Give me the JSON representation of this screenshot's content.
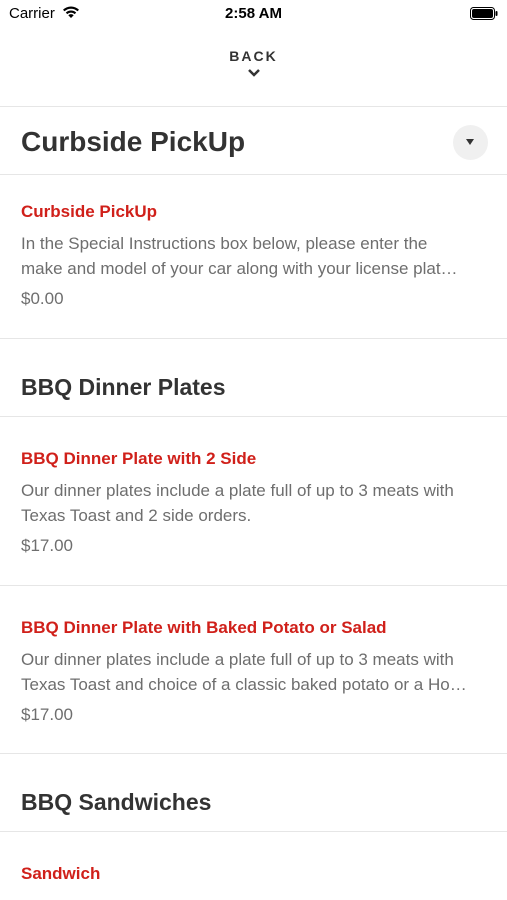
{
  "status_bar": {
    "carrier": "Carrier",
    "time": "2:58 AM"
  },
  "nav": {
    "back_label": "BACK"
  },
  "categories": [
    {
      "title": "Curbside PickUp",
      "items": [
        {
          "name": "Curbside PickUp",
          "desc_line1": "In the Special Instructions box below, please enter the",
          "desc_line2": "make and model of your car along with your license plat…",
          "price": "$0.00"
        }
      ]
    },
    {
      "title": "BBQ Dinner Plates",
      "items": [
        {
          "name": "BBQ Dinner Plate with 2 Side",
          "desc_line1": "Our dinner plates include a plate full of up to 3 meats with",
          "desc_line2": "Texas Toast and 2 side orders.",
          "price": "$17.00"
        },
        {
          "name": "BBQ Dinner Plate with Baked Potato or Salad",
          "desc_line1": "Our dinner plates include a plate full of up to 3 meats with",
          "desc_line2": "Texas Toast and choice of a classic baked potato or a Ho…",
          "price": "$17.00"
        }
      ]
    },
    {
      "title": "BBQ Sandwiches",
      "items": [
        {
          "name": "Sandwich"
        }
      ]
    }
  ],
  "colors": {
    "item_name": "#d0201a",
    "text_muted": "#6e6e6e",
    "divider": "#e6e6e6"
  },
  "icons": {
    "wifi": "wifi-icon",
    "battery": "battery-icon",
    "back_chevron": "chevron-down-icon",
    "dropdown": "caret-down-icon"
  }
}
